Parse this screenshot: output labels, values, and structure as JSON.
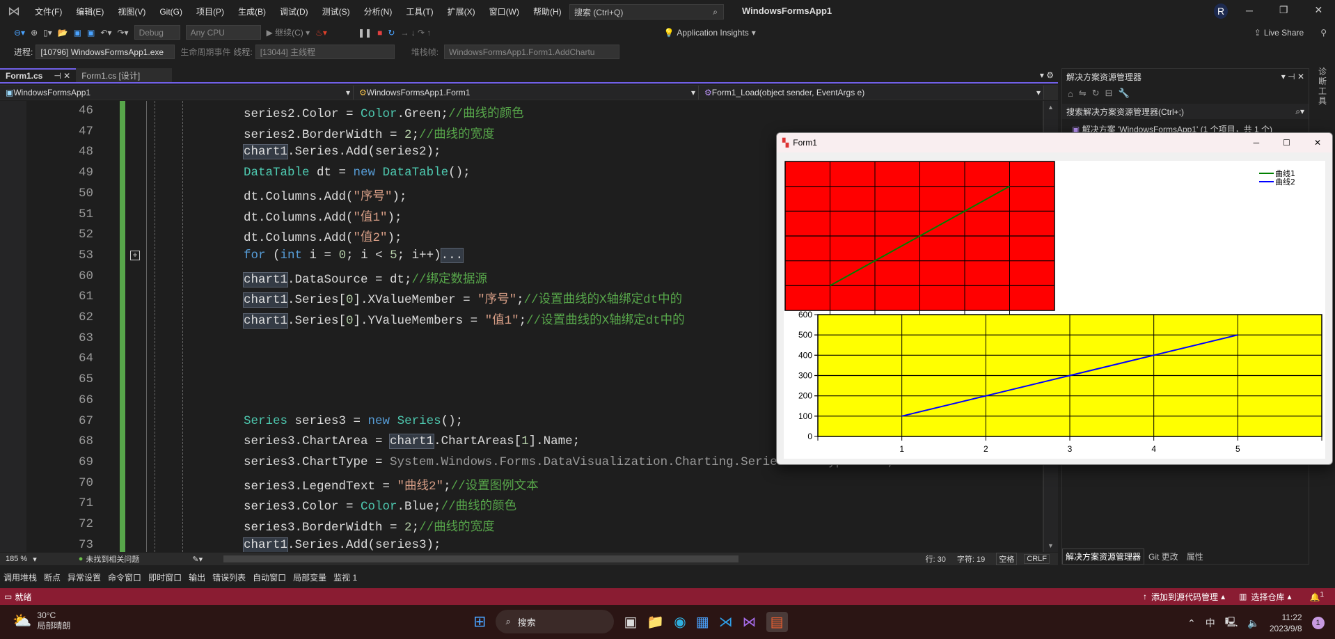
{
  "menu": {
    "items": [
      "文件(F)",
      "编辑(E)",
      "视图(V)",
      "Git(G)",
      "项目(P)",
      "生成(B)",
      "调试(D)",
      "测试(S)",
      "分析(N)",
      "工具(T)",
      "扩展(X)",
      "窗口(W)",
      "帮助(H)"
    ],
    "search": "搜索 (Ctrl+Q)",
    "title": "WindowsFormsApp1",
    "avatar": "R"
  },
  "toolbar": {
    "config": "Debug",
    "platform": "Any CPU",
    "continue": "继续(C)",
    "insights": "Application Insights",
    "liveshare": "Live Share"
  },
  "debugbar": {
    "process_label": "进程:",
    "process": "[10796] WindowsFormsApp1.exe",
    "lifecycle": "生命周期事件",
    "thread_label": "线程:",
    "thread": "[13044] 主线程",
    "stack_label": "堆栈帧:",
    "stack": "WindowsFormsApp1.Form1.AddChartu"
  },
  "tabs": [
    {
      "label": "Form1.cs",
      "active": true
    },
    {
      "label": "Form1.cs [设计]",
      "active": false
    }
  ],
  "nav": {
    "project": "WindowsFormsApp1",
    "class": "WindowsFormsApp1.Form1",
    "member": "Form1_Load(object sender, EventArgs e)"
  },
  "code": [
    {
      "n": "46",
      "t": [
        [
          "series2.Color = ",
          ""
        ],
        [
          "Color",
          "type"
        ],
        [
          ".Green;",
          ""
        ],
        [
          "//曲线的颜色",
          "cm"
        ]
      ]
    },
    {
      "n": "47",
      "t": [
        [
          "series2.BorderWidth = ",
          ""
        ],
        [
          "2",
          "num"
        ],
        [
          ";",
          ""
        ],
        [
          "//曲线的宽度",
          "cm"
        ]
      ]
    },
    {
      "n": "48",
      "t": [
        [
          "chart1",
          "hl"
        ],
        [
          ".Series.Add(series2);",
          ""
        ]
      ]
    },
    {
      "n": "49",
      "t": [
        [
          "DataTable",
          "type"
        ],
        [
          " dt = ",
          ""
        ],
        [
          "new",
          "kw"
        ],
        [
          " ",
          ""
        ],
        [
          "DataTable",
          "type"
        ],
        [
          "();",
          ""
        ]
      ]
    },
    {
      "n": "50",
      "t": [
        [
          "dt.Columns.Add(",
          ""
        ],
        [
          "\"序号\"",
          "str"
        ],
        [
          ");",
          ""
        ]
      ]
    },
    {
      "n": "51",
      "t": [
        [
          "dt.Columns.Add(",
          ""
        ],
        [
          "\"值1\"",
          "str"
        ],
        [
          ");",
          ""
        ]
      ]
    },
    {
      "n": "52",
      "t": [
        [
          "dt.Columns.Add(",
          ""
        ],
        [
          "\"值2\"",
          "str"
        ],
        [
          ");",
          ""
        ]
      ]
    },
    {
      "n": "53",
      "t": [
        [
          "for",
          "kw"
        ],
        [
          " (",
          ""
        ],
        [
          "int",
          "kw"
        ],
        [
          " i = ",
          ""
        ],
        [
          "0",
          "num"
        ],
        [
          "; i < ",
          ""
        ],
        [
          "5",
          "num"
        ],
        [
          "; i++)",
          ""
        ],
        [
          "...",
          "hl"
        ]
      ]
    },
    {
      "n": "60",
      "t": [
        [
          "chart1",
          "hl"
        ],
        [
          ".DataSource = dt;",
          ""
        ],
        [
          "//绑定数据源",
          "cm"
        ]
      ]
    },
    {
      "n": "61",
      "t": [
        [
          "chart1",
          "hl"
        ],
        [
          ".Series[",
          ""
        ],
        [
          "0",
          "num"
        ],
        [
          "].XValueMember = ",
          ""
        ],
        [
          "\"序号\"",
          "str"
        ],
        [
          ";",
          ""
        ],
        [
          "//设置曲线的X轴绑定dt中的",
          "cm"
        ]
      ]
    },
    {
      "n": "62",
      "t": [
        [
          "chart1",
          "hl"
        ],
        [
          ".Series[",
          ""
        ],
        [
          "0",
          "num"
        ],
        [
          "].YValueMembers = ",
          ""
        ],
        [
          "\"值1\"",
          "str"
        ],
        [
          ";",
          ""
        ],
        [
          "//设置曲线的X轴绑定dt中的",
          "cm"
        ]
      ]
    },
    {
      "n": "63",
      "t": []
    },
    {
      "n": "64",
      "t": []
    },
    {
      "n": "65",
      "t": []
    },
    {
      "n": "66",
      "t": []
    },
    {
      "n": "67",
      "t": [
        [
          "Series",
          "type"
        ],
        [
          " series3 = ",
          ""
        ],
        [
          "new",
          "kw"
        ],
        [
          " ",
          ""
        ],
        [
          "Series",
          "type"
        ],
        [
          "();",
          ""
        ]
      ]
    },
    {
      "n": "68",
      "t": [
        [
          "series3.ChartArea = ",
          ""
        ],
        [
          "chart1",
          "hl"
        ],
        [
          ".ChartAreas[",
          ""
        ],
        [
          "1",
          "num"
        ],
        [
          "].Name;",
          ""
        ]
      ]
    },
    {
      "n": "69",
      "t": [
        [
          "series3.ChartType = ",
          ""
        ],
        [
          "System.Windows.Forms.DataVisualization.Charting.SeriesChartType.Line;",
          "dim"
        ]
      ]
    },
    {
      "n": "70",
      "t": [
        [
          "series3.LegendText = ",
          ""
        ],
        [
          "\"曲线2\"",
          "str"
        ],
        [
          ";",
          ""
        ],
        [
          "//设置图例文本",
          "cm"
        ]
      ]
    },
    {
      "n": "71",
      "t": [
        [
          "series3.Color = ",
          ""
        ],
        [
          "Color",
          "type"
        ],
        [
          ".Blue;",
          ""
        ],
        [
          "//曲线的颜色",
          "cm"
        ]
      ]
    },
    {
      "n": "72",
      "t": [
        [
          "series3.BorderWidth = ",
          ""
        ],
        [
          "2",
          "num"
        ],
        [
          ";",
          ""
        ],
        [
          "//曲线的宽度",
          "cm"
        ]
      ]
    },
    {
      "n": "73",
      "t": [
        [
          "chart1",
          "hl"
        ],
        [
          ".Series.Add(series3);",
          ""
        ]
      ]
    }
  ],
  "editor_status": {
    "zoom": "185 %",
    "issues": "未找到相关问题",
    "line": "行: 30",
    "char": "字符: 19",
    "spaces": "空格",
    "eol": "CRLF"
  },
  "bottom_tabs": [
    "调用堆栈",
    "断点",
    "异常设置",
    "命令窗口",
    "即时窗口",
    "输出",
    "错误列表",
    "自动窗口",
    "局部变量",
    "监视 1"
  ],
  "status": {
    "ready": "就绪",
    "source_control": "添加到源代码管理",
    "repo": "选择仓库",
    "notif": "1"
  },
  "solution": {
    "title": "解决方案资源管理器",
    "search": "搜索解决方案资源管理器(Ctrl+;)",
    "item": "解决方案 'WindowsFormsApp1' (1 个项目，共 1 个)",
    "tabs": [
      "解决方案资源管理器",
      "Git 更改",
      "属性"
    ],
    "side": "诊断工具"
  },
  "taskbar": {
    "temp": "30°C",
    "weather": "局部晴朗",
    "weather_badge": "1",
    "search": "搜索",
    "ime": "中",
    "time": "11:22",
    "date": "2023/9/8",
    "notif": "1"
  },
  "form": {
    "title": "Form1"
  },
  "chart_data": [
    {
      "type": "line",
      "area": "top",
      "background": "#ff0000",
      "axes_visible": false,
      "grid": true,
      "xlim": [
        0,
        6
      ],
      "ylim": [
        0,
        6
      ],
      "series": [
        {
          "name": "曲线1",
          "color": "#008000",
          "x": [
            1,
            2,
            3,
            4,
            5
          ],
          "y": [
            1,
            2,
            3,
            4,
            5
          ]
        }
      ]
    },
    {
      "type": "line",
      "area": "bottom",
      "background": "#ffff00",
      "grid": true,
      "xlim": [
        0,
        6
      ],
      "ylim": [
        0,
        600
      ],
      "xticks": [
        1,
        2,
        3,
        4,
        5
      ],
      "yticks": [
        0,
        100,
        200,
        300,
        400,
        500,
        600
      ],
      "series": [
        {
          "name": "曲线2",
          "color": "#0000ff",
          "x": [
            1,
            2,
            3,
            4,
            5
          ],
          "y": [
            100,
            200,
            300,
            400,
            500
          ]
        }
      ],
      "legend": "top-right"
    }
  ]
}
